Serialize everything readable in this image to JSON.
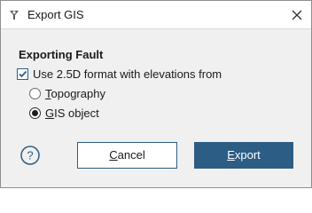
{
  "window": {
    "title": "Export GIS",
    "app_icon": "map-pin-icon",
    "close_icon": "close-icon"
  },
  "section": {
    "heading": "Exporting Fault"
  },
  "options": {
    "use_25d_label": "Use 2.5D format with elevations from",
    "use_25d_checked": true,
    "radio_topography_label": "Topography",
    "radio_gis_object_label": "GIS object",
    "selected": "GIS object"
  },
  "footer": {
    "help_icon": "help-icon",
    "cancel_label": "Cancel",
    "export_label": "Export"
  },
  "colors": {
    "primary_button": "#2c5d85",
    "body_background": "#f0f0f0"
  }
}
